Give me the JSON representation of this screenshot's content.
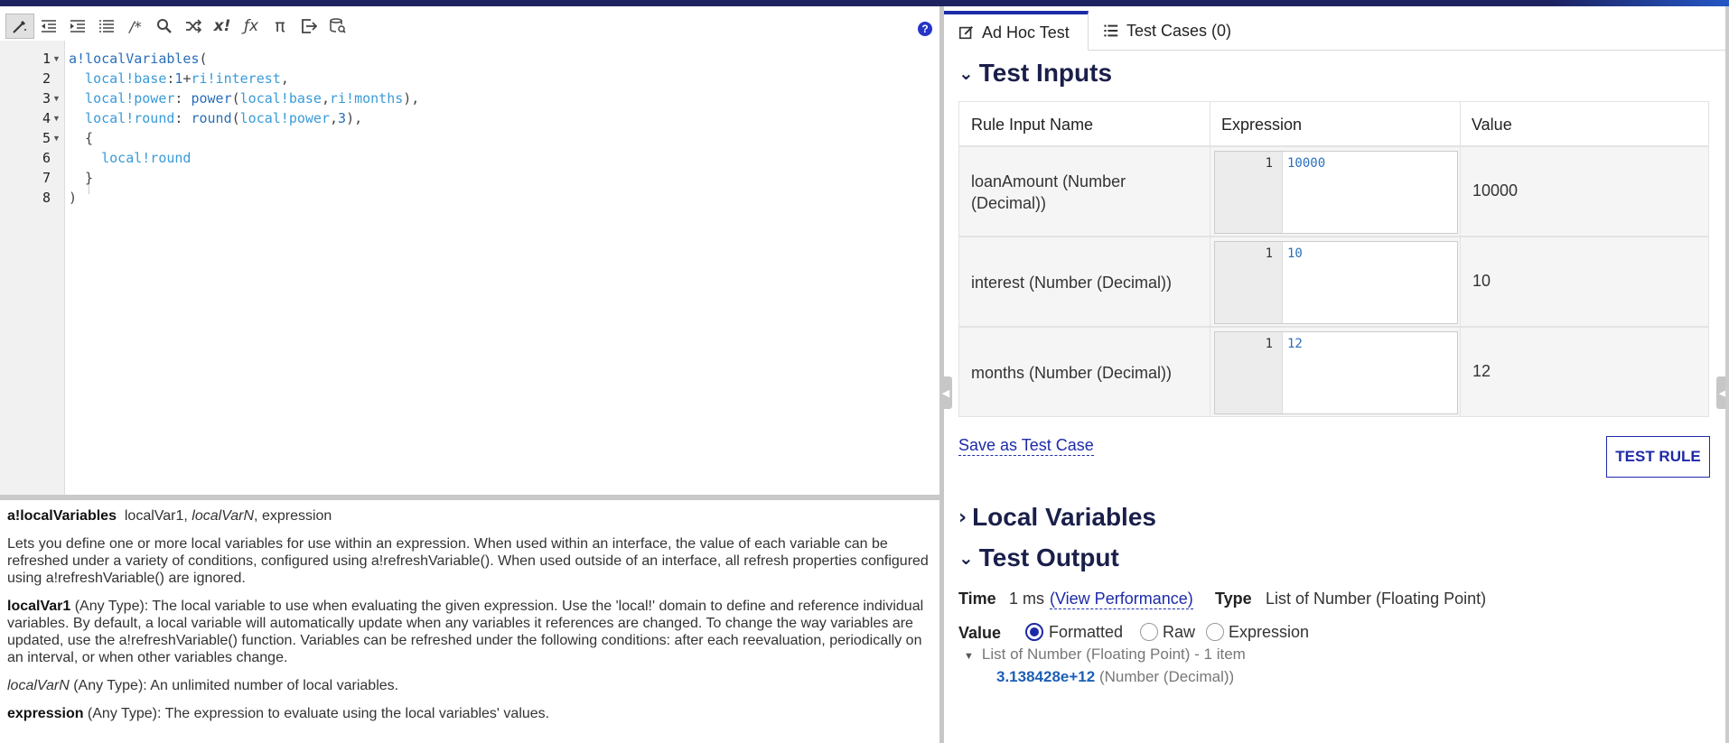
{
  "editor": {
    "line_numbers": [
      "1",
      "2",
      "3",
      "4",
      "5",
      "6",
      "7",
      "8"
    ],
    "lines": [
      [
        {
          "t": "a!localVariables",
          "c": "fn"
        },
        {
          "t": "(",
          "c": "punct"
        }
      ],
      [
        {
          "t": "  local!base",
          "c": "dom"
        },
        {
          "t": ":",
          "c": "punct"
        },
        {
          "t": "1",
          "c": "num"
        },
        {
          "t": "+",
          "c": "punct"
        },
        {
          "t": "ri!interest",
          "c": "dom"
        },
        {
          "t": ",",
          "c": "punct"
        }
      ],
      [
        {
          "t": "  local!power",
          "c": "dom"
        },
        {
          "t": ": ",
          "c": "punct"
        },
        {
          "t": "power",
          "c": "fn"
        },
        {
          "t": "(",
          "c": "punct"
        },
        {
          "t": "local!base",
          "c": "dom"
        },
        {
          "t": ",",
          "c": "punct"
        },
        {
          "t": "ri!months",
          "c": "dom"
        },
        {
          "t": "),",
          "c": "punct"
        }
      ],
      [
        {
          "t": "  local!round",
          "c": "dom"
        },
        {
          "t": ": ",
          "c": "punct"
        },
        {
          "t": "round",
          "c": "fn"
        },
        {
          "t": "(",
          "c": "punct"
        },
        {
          "t": "local!power",
          "c": "dom"
        },
        {
          "t": ",",
          "c": "punct"
        },
        {
          "t": "3",
          "c": "num"
        },
        {
          "t": "),",
          "c": "punct"
        }
      ],
      [
        {
          "t": "  {",
          "c": "punct"
        }
      ],
      [
        {
          "t": "    local!round",
          "c": "dom"
        }
      ],
      [
        {
          "t": "  }",
          "c": "punct"
        }
      ],
      [
        {
          "t": ")",
          "c": "punct"
        }
      ]
    ]
  },
  "docs": {
    "signature_name": "a!localVariables",
    "signature_arg1": "localVar1,",
    "signature_arg2": "localVarN",
    "signature_arg3": ", expression",
    "description": "Lets you define one or more local variables for use within an expression. When used within an interface, the value of each variable can be refreshed under a variety of conditions, configured using a!refreshVariable(). When used outside of an interface, all refresh properties configured using a!refreshVariable() are ignored.",
    "param1_name": "localVar1",
    "param1_desc": " (Any Type): The local variable to use when evaluating the given expression. Use the 'local!' domain to define and reference individual variables. By default, a local variable will automatically update when any variables it references are changed. To change the way variables are updated, use the a!refreshVariable() function. Variables can be refreshed under the following conditions: after each reevaluation, periodically on an interval, or when other variables change.",
    "param2_name": "localVarN",
    "param2_desc": " (Any Type): An unlimited number of local variables.",
    "param3_name": "expression",
    "param3_desc": " (Any Type): The expression to evaluate using the local variables' values."
  },
  "help_icon": "?",
  "tabs": {
    "adhoc": "Ad Hoc Test",
    "cases": "Test Cases (0)"
  },
  "test_inputs": {
    "title": "Test Inputs",
    "headers": {
      "name": "Rule Input Name",
      "expression": "Expression",
      "value": "Value"
    },
    "rows": [
      {
        "name": "loanAmount (Number (Decimal))",
        "line": "1",
        "expression": "10000",
        "value": "10000"
      },
      {
        "name": "interest (Number (Decimal))",
        "line": "1",
        "expression": "10",
        "value": "10"
      },
      {
        "name": "months (Number (Decimal))",
        "line": "1",
        "expression": "12",
        "value": "12"
      }
    ]
  },
  "actions": {
    "save_link": "Save as Test Case",
    "test_rule": "TEST RULE"
  },
  "local_variables": {
    "title": "Local Variables"
  },
  "test_output": {
    "title": "Test Output",
    "time_label": "Time",
    "time_value": "1 ms",
    "view_performance": "(View Performance)",
    "type_label": "Type",
    "type_value": "List of Number (Floating Point)",
    "value_label": "Value",
    "radio_formatted": "Formatted",
    "radio_raw": "Raw",
    "radio_expression": "Expression",
    "list_header": "List of Number (Floating Point) - 1 item",
    "result_value": "3.138428e+12",
    "result_type": "(Number (Decimal))"
  },
  "colors": {
    "accent": "#1d2aa8",
    "header_text": "#1a1f4a",
    "topbar": "#1d2260"
  }
}
